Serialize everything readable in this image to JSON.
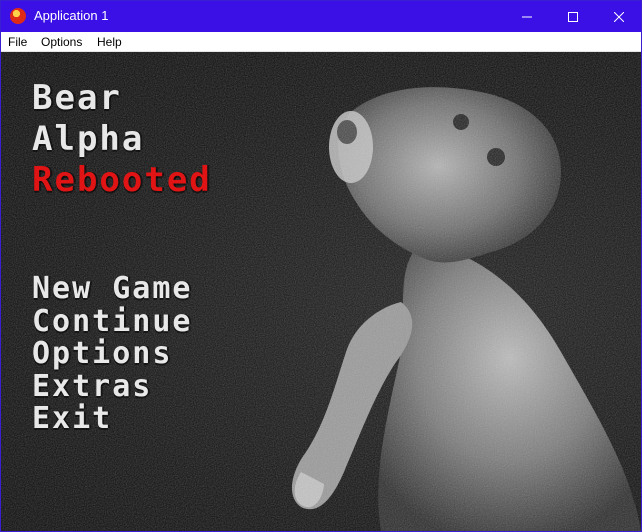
{
  "window": {
    "title": "Application 1",
    "accent": "#3a10e6"
  },
  "menubar": {
    "items": [
      "File",
      "Options",
      "Help"
    ]
  },
  "game": {
    "title_lines": [
      "Bear",
      "Alpha",
      "Rebooted"
    ],
    "title_accent_color": "#e01414",
    "menu": [
      "New Game",
      "Continue",
      "Options",
      "Extras",
      "Exit"
    ]
  }
}
